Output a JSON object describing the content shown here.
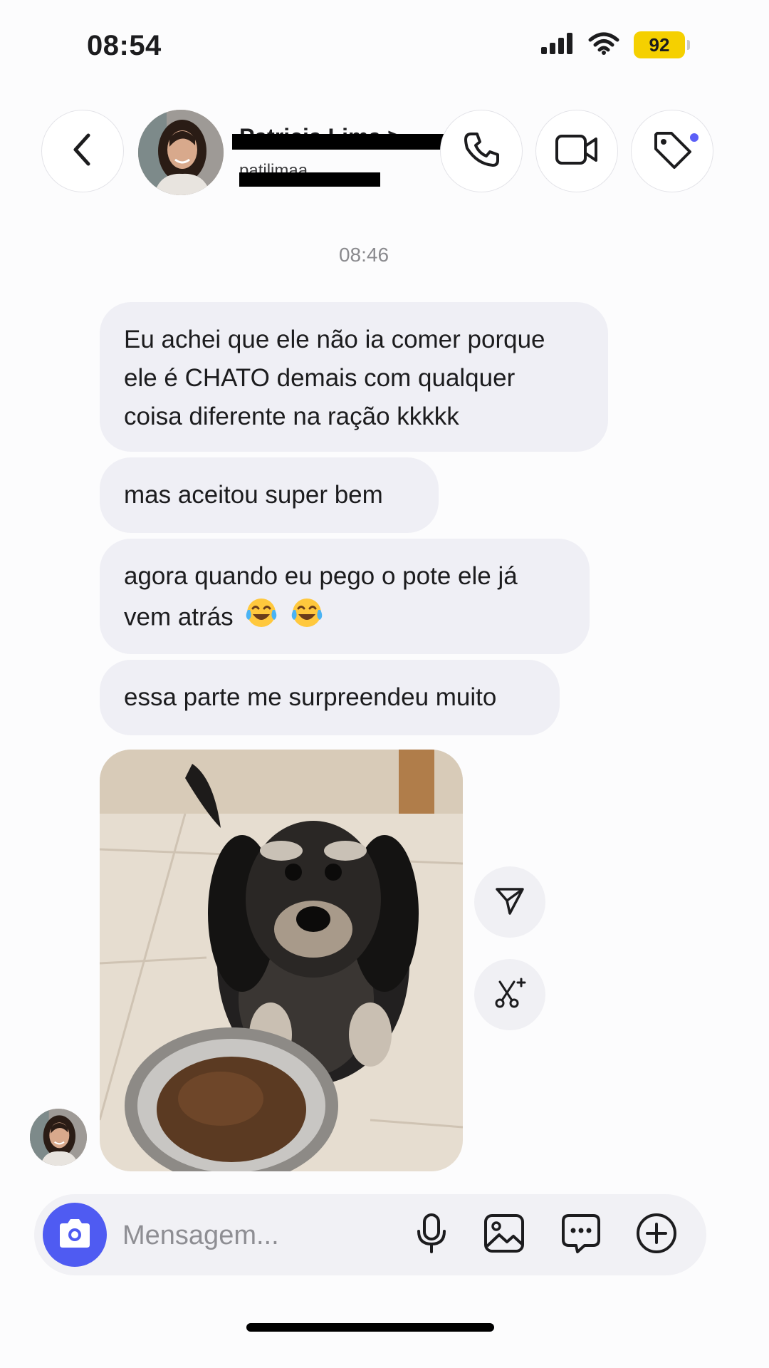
{
  "status_bar": {
    "time": "08:54",
    "battery": "92",
    "icons": [
      "cellular-signal-icon",
      "wifi-icon",
      "battery-icon"
    ]
  },
  "header": {
    "contact_name": "Patricia Lima >",
    "contact_handle": "patilimaa",
    "icons": [
      "back-chevron-icon",
      "phone-icon",
      "video-camera-icon",
      "tag-icon"
    ],
    "accent_color": "#5b5ff7"
  },
  "conversation": {
    "timestamp": "08:46",
    "messages": [
      {
        "line1": "Eu achei que ele não ia comer porque",
        "line2": "ele é CHATO demais com qualquer",
        "line3": "coisa diferente na ração kkkkk"
      },
      {
        "text": "mas aceitou super bem"
      },
      {
        "line1": "agora quando eu pego o pote ele já",
        "line2": "vem atrás",
        "emoji": "face-with-tears-of-joy x2"
      },
      {
        "text": "essa parte me surpreendeu muito"
      }
    ],
    "photo_icon": "dog-with-food-bowl-photo",
    "side_actions": [
      "share-send-icon",
      "remix-scissors-icon"
    ]
  },
  "composer": {
    "placeholder": "Mensagem...",
    "icons": [
      "camera-icon",
      "microphone-icon",
      "gallery-icon",
      "chat-bubble-icon",
      "plus-circle-icon"
    ],
    "camera_color": "#4f5bf2"
  }
}
